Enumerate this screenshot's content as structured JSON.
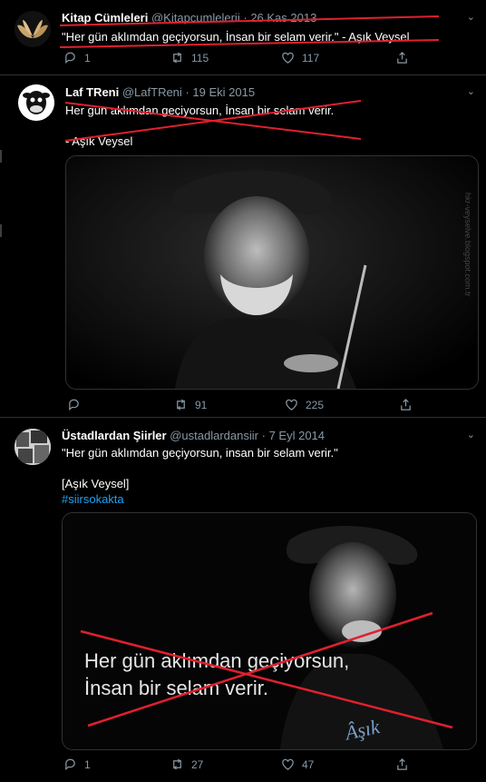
{
  "tweets": [
    {
      "display_name": "Kitap Cümleleri",
      "handle": "@Kitapcumlelerii",
      "date": "26 Kas 2013",
      "text": "\"Her gün aklımdan geçiyorsun, İnsan bir selam verir.\" - Aşık Veysel",
      "hashtag": "",
      "reply_count": "1",
      "retweet_count": "115",
      "like_count": "117"
    },
    {
      "display_name": "Laf TReni",
      "handle": "@LafTReni",
      "date": "19 Eki 2015",
      "text": "Her gün aklımdan geçiyorsun, İnsan bir selam verir.\n\n- Aşık Veysel",
      "hashtag": "",
      "reply_count": "",
      "retweet_count": "91",
      "like_count": "225",
      "media_watermark": "hkr-veyselve.blogspot.com.tr"
    },
    {
      "display_name": "Üstadlardan Şiirler",
      "handle": "@ustadlardansiir",
      "date": "7 Eyl 2014",
      "text": "\"Her gün aklımdan geçiyorsun, insan bir selam verir.\"\n\n[Aşık Veysel]",
      "hashtag": "#siirsokakta",
      "reply_count": "1",
      "retweet_count": "27",
      "like_count": "47",
      "media_caption_line1": "Her gün aklımdan geçiyorsun,",
      "media_caption_line2": "İnsan bir selam verir.",
      "media_signature": "Âşık"
    }
  ],
  "ui": {
    "separator": "·",
    "chevron": "⌄",
    "accent": "#1da1f2",
    "strike_color": "#e0202e"
  }
}
